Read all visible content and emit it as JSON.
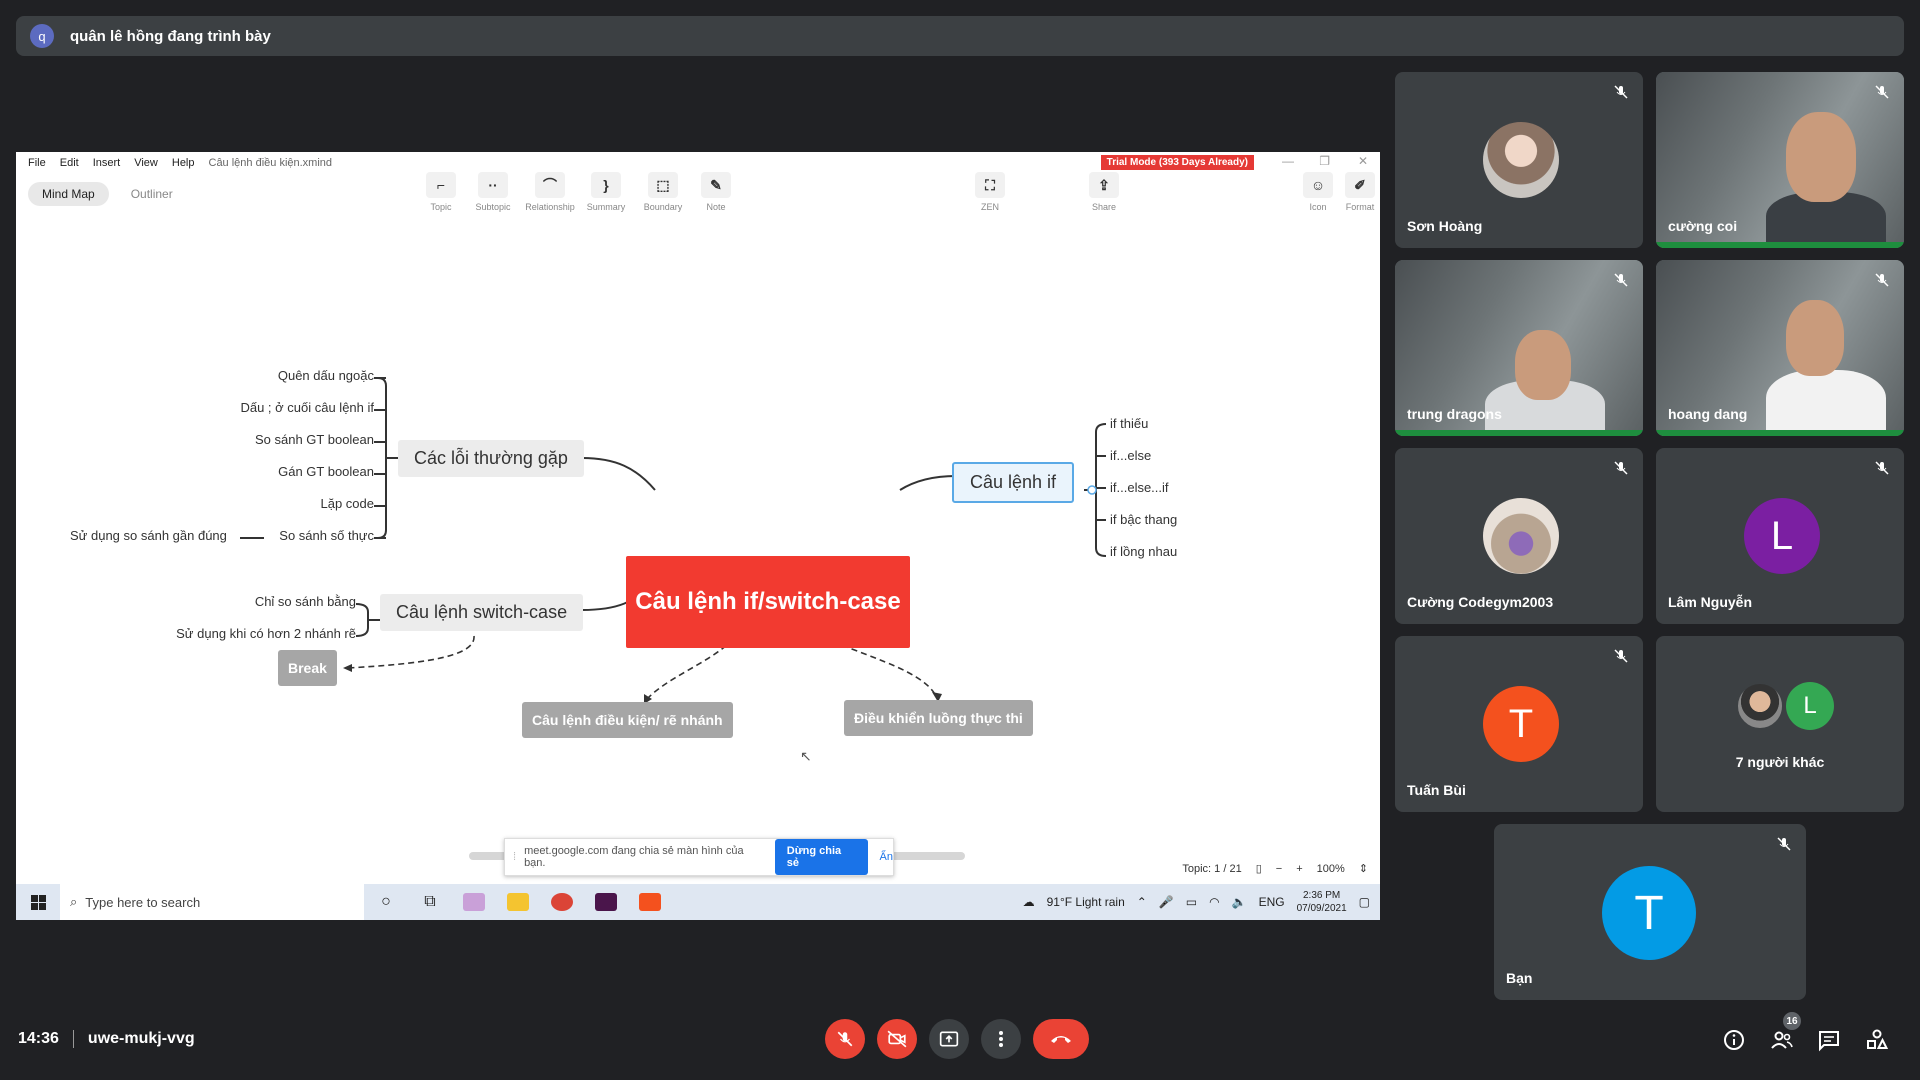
{
  "presenter": {
    "initial": "q",
    "text": "quân lê hồng đang trình bày"
  },
  "app": {
    "menu": [
      "File",
      "Edit",
      "Insert",
      "View",
      "Help"
    ],
    "file_title": "Câu lệnh điều kiện.xmind",
    "trial": "Trial Mode (393 Days Already)",
    "modes": [
      "Mind Map",
      "Outliner"
    ],
    "tools": [
      {
        "label": "Topic",
        "icon": "topic-icon"
      },
      {
        "label": "Subtopic",
        "icon": "subtopic-icon"
      },
      {
        "label": "Relationship",
        "icon": "relationship-icon"
      },
      {
        "label": "Summary",
        "icon": "summary-icon"
      },
      {
        "label": "Boundary",
        "icon": "boundary-icon"
      },
      {
        "label": "Note",
        "icon": "note-icon"
      },
      {
        "label": "ZEN",
        "icon": "zen-icon"
      },
      {
        "label": "Share",
        "icon": "share-icon"
      },
      {
        "label": "Icon",
        "icon": "emoji-icon"
      },
      {
        "label": "Format",
        "icon": "format-icon"
      }
    ]
  },
  "mindmap": {
    "central": "Câu lệnh if/switch-case",
    "topic_errors": "Các lỗi thường gặp",
    "errors": [
      "Quên dấu ngoặc",
      "Dấu ; ở cuối câu lệnh if",
      "So sánh GT boolean",
      "Gán GT boolean",
      "Lặp code",
      "So sánh số thực"
    ],
    "error_child": "Sử dụng so sánh gần đúng",
    "topic_switch": "Câu lệnh switch-case",
    "switch_items": [
      "Chỉ so sánh bằng",
      "Sử dụng khi có hơn 2 nhánh rẽ"
    ],
    "topic_break": "Break",
    "topic_if": "Câu lệnh if",
    "if_items": [
      "if thiếu",
      "if...else",
      "if...else...if",
      "if bậc thang",
      "if lồng nhau"
    ],
    "float_left": "Câu lệnh điều kiện/ rẽ nhánh",
    "float_right": "Điều khiển luồng thực thi"
  },
  "share_notice": {
    "text": "meet.google.com đang chia sẻ màn hình của bạn.",
    "stop": "Dừng chia sẻ",
    "hide": "Ẩn"
  },
  "status": {
    "topic": "Topic: 1 / 21",
    "zoom": "100%"
  },
  "taskbar": {
    "search_placeholder": "Type here to search",
    "weather": "91°F  Light rain",
    "lang": "ENG",
    "time": "2:36 PM",
    "date": "07/09/2021"
  },
  "participants": [
    {
      "name": "Sơn Hoàng",
      "type": "photo"
    },
    {
      "name": "cường coi",
      "type": "video"
    },
    {
      "name": "trung dragons",
      "type": "video"
    },
    {
      "name": "hoang dang",
      "type": "video"
    },
    {
      "name": "Cường Codegym2003",
      "type": "photo"
    },
    {
      "name": "Lâm Nguyễn",
      "type": "letter",
      "letter": "L",
      "color": "#7b1fa2"
    },
    {
      "name": "Tuấn Bùi",
      "type": "letter",
      "letter": "T",
      "color": "#f4511e"
    },
    {
      "name": "7 người khác",
      "type": "others",
      "letter": "L"
    },
    {
      "name": "Bạn",
      "type": "letter",
      "letter": "T",
      "color": "#039be5"
    }
  ],
  "meeting": {
    "time": "14:36",
    "code": "uwe-mukj-vvg",
    "participant_count": "16"
  },
  "colors": {
    "end_call": "#ea4335",
    "central_topic": "#f23a30",
    "selection": "#5aa9e6"
  }
}
